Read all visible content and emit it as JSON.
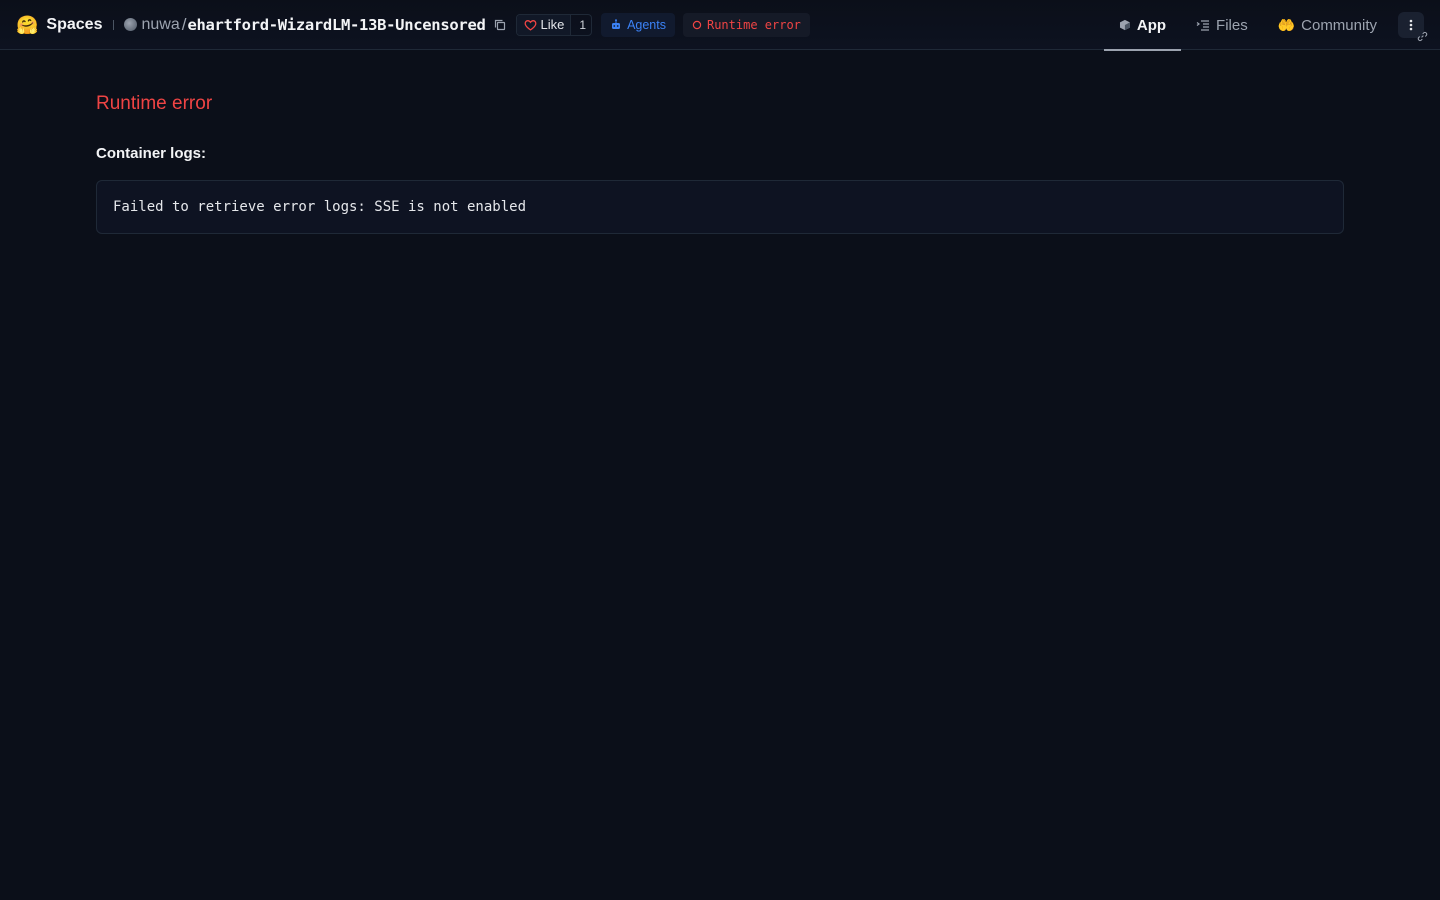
{
  "header": {
    "brand_emoji": "🤗",
    "brand_label": "Spaces",
    "owner": "nuwa",
    "separator": "/",
    "repo_name": "ehartford-WizardLM-13B-Uncensored",
    "like_label": "Like",
    "like_count": "1",
    "agents_label": "Agents",
    "status_label": "Runtime error"
  },
  "nav": {
    "tabs": [
      {
        "label": "App",
        "icon": "cube-icon",
        "active": true
      },
      {
        "label": "Files",
        "icon": "files-icon",
        "active": false
      },
      {
        "label": "Community",
        "icon": "community-emoji-icon",
        "active": false
      }
    ],
    "community_emoji": "🤲"
  },
  "main": {
    "title": "Runtime error",
    "logs_label": "Container logs:",
    "logs_text": "Failed to retrieve error logs: SSE is not enabled"
  },
  "colors": {
    "background": "#0b0f19",
    "error": "#ef4444",
    "agents": "#3b82f6"
  }
}
